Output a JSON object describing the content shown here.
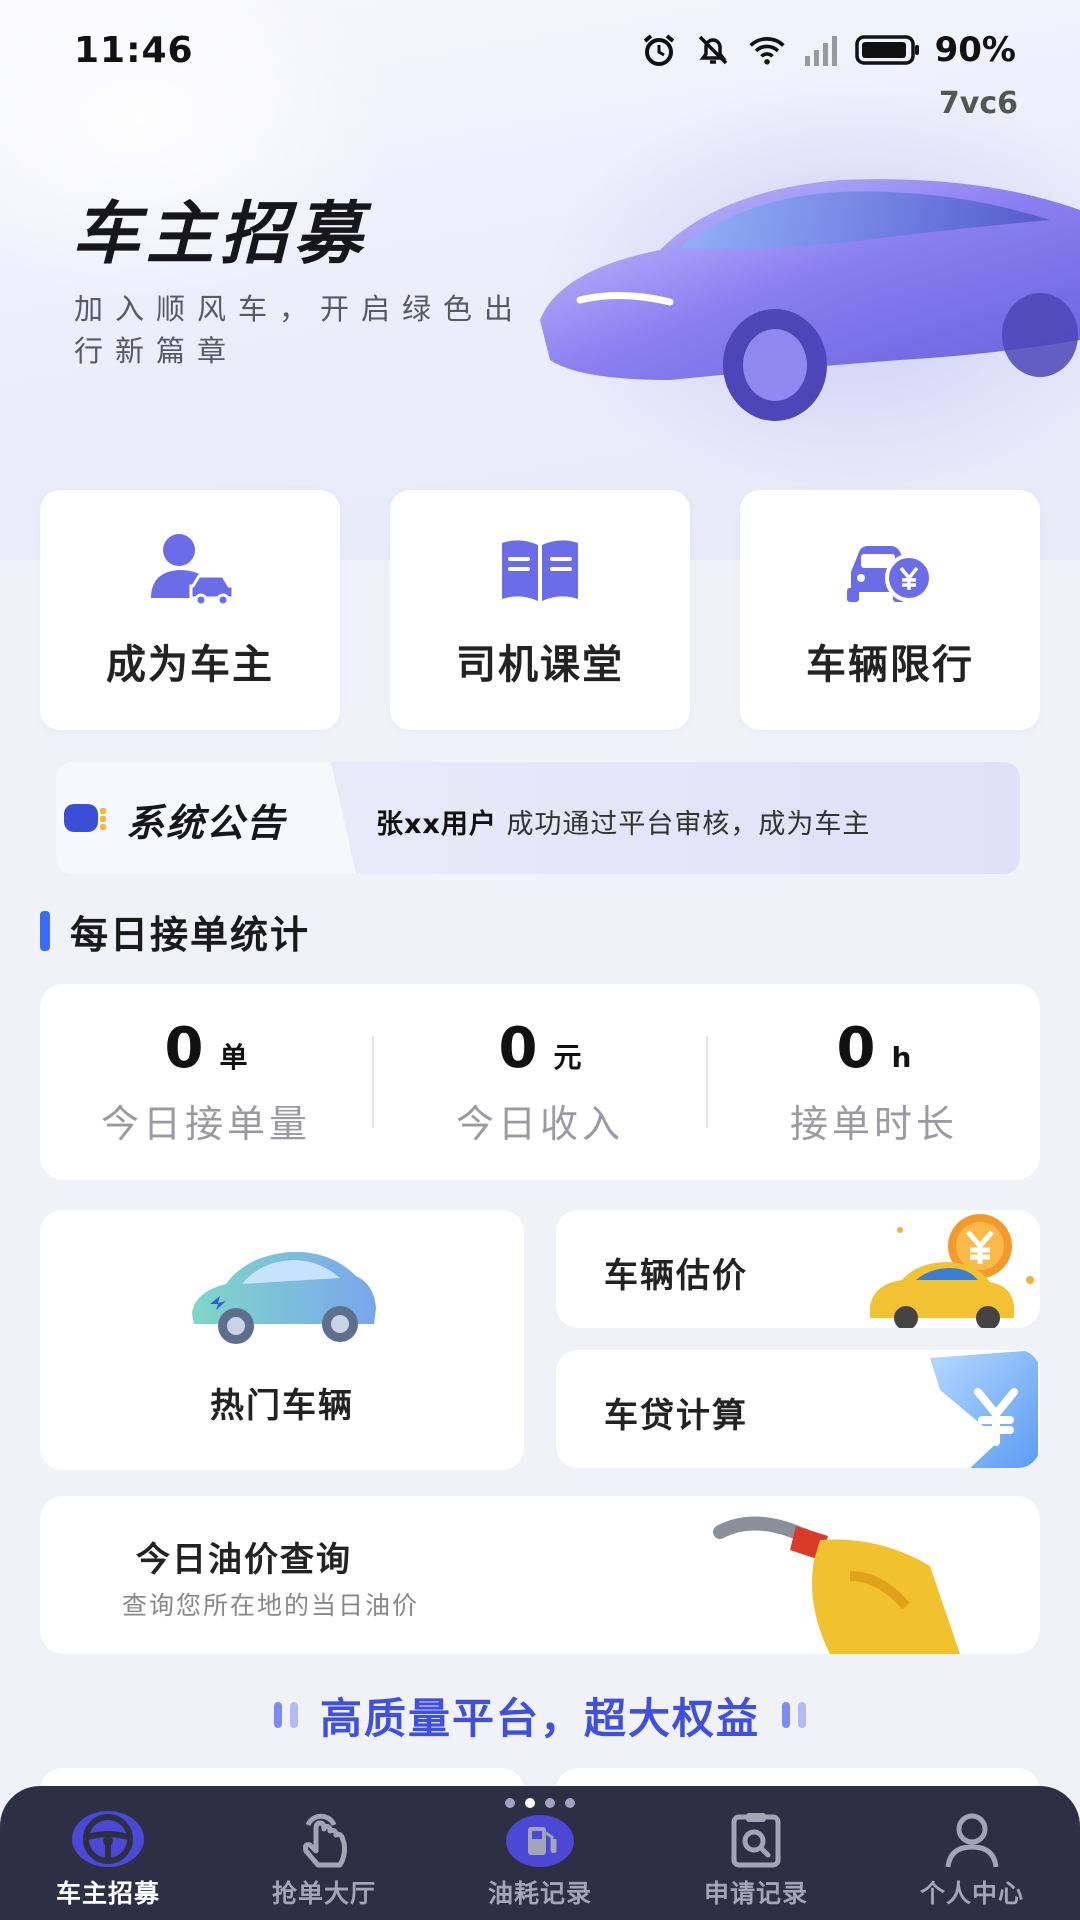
{
  "status_bar": {
    "time": "11:46",
    "battery": "90%",
    "build_tag": "7vc6",
    "icons": [
      "alarm-icon",
      "mute-icon",
      "wifi-icon",
      "signal-icon",
      "battery-icon"
    ]
  },
  "hero": {
    "title": "车主招募",
    "subtitle": "加入顺风车，开启绿色出行新篇章"
  },
  "features": [
    {
      "label": "成为车主",
      "icon": "driver-car-icon"
    },
    {
      "label": "司机课堂",
      "icon": "book-icon"
    },
    {
      "label": "车辆限行",
      "icon": "car-yuan-icon"
    }
  ],
  "notice": {
    "title": "系统公告",
    "user": "张xx用户",
    "message": "成功通过平台审核，成为车主"
  },
  "daily_stats": {
    "title": "每日接单统计",
    "items": [
      {
        "value": "0",
        "unit": "单",
        "label": "今日接单量"
      },
      {
        "value": "0",
        "unit": "元",
        "label": "今日收入"
      },
      {
        "value": "0",
        "unit": "h",
        "label": "接单时长"
      }
    ]
  },
  "tiles": {
    "hot_cars": "热门车辆",
    "valuation": "车辆估价",
    "loan_calc": "车贷计算",
    "oil_title": "今日油价查询",
    "oil_sub": "查询您所在地的当日油价"
  },
  "banner": "高质量平台，超大权益",
  "bottom_nav": [
    {
      "label": "车主招募",
      "icon": "steering-wheel-icon",
      "active": true
    },
    {
      "label": "抢单大厅",
      "icon": "tap-hand-icon",
      "active": false
    },
    {
      "label": "油耗记录",
      "icon": "fuel-pump-icon",
      "active": false
    },
    {
      "label": "申请记录",
      "icon": "clipboard-search-icon",
      "active": false
    },
    {
      "label": "个人中心",
      "icon": "person-icon",
      "active": false
    }
  ],
  "colors": {
    "accent": "#3f4fe0",
    "icon_purple": "#6b6de8",
    "nav_bg": "#2d2f45"
  }
}
